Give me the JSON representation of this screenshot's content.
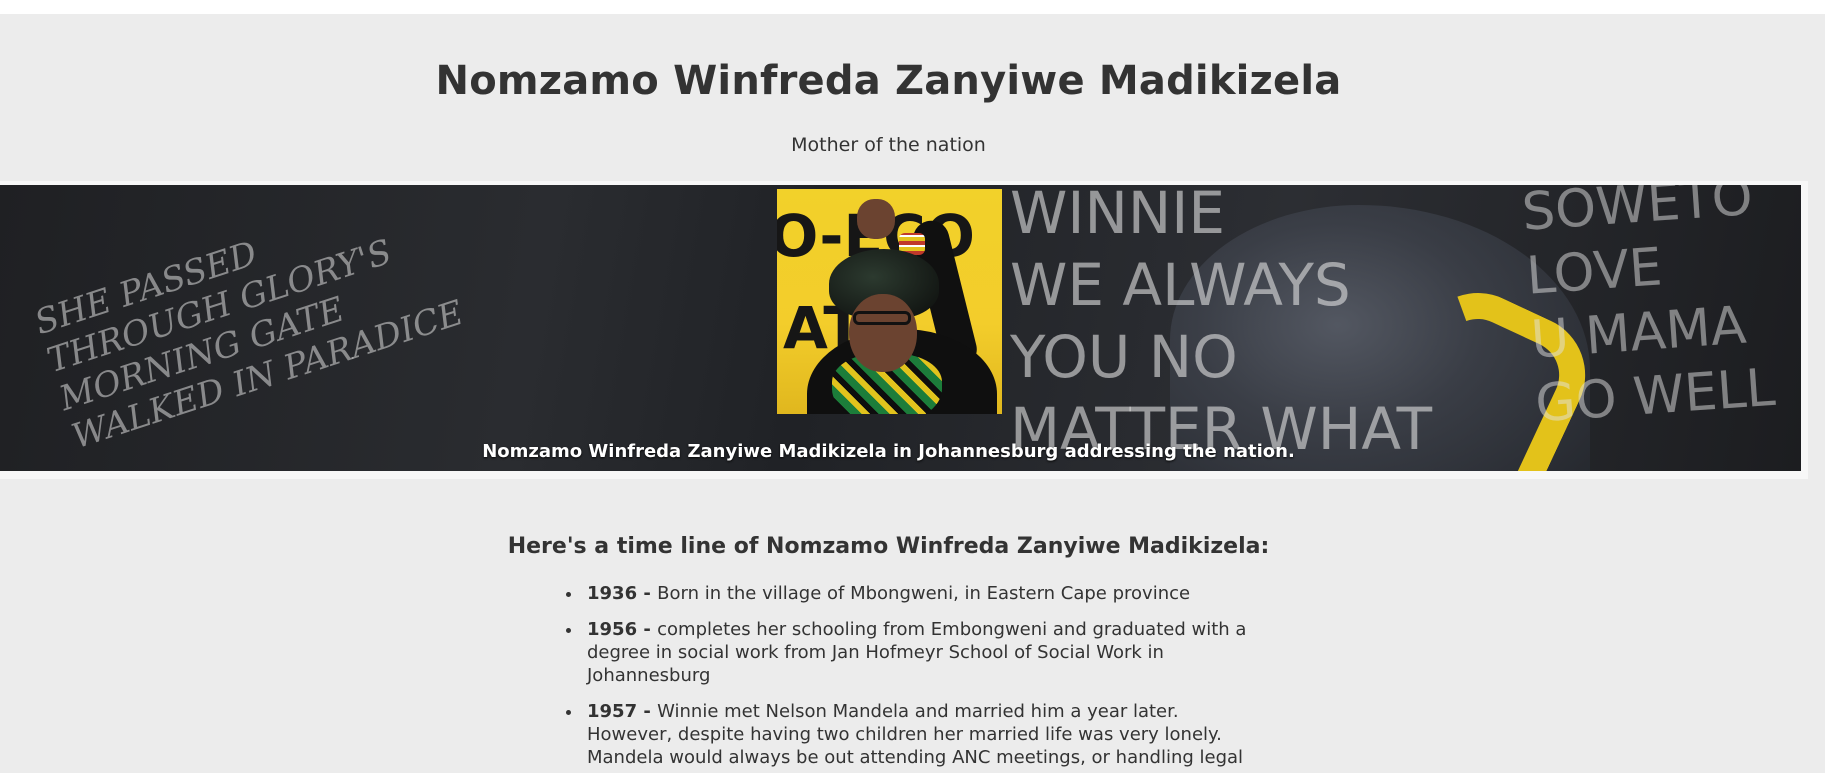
{
  "header": {
    "title": "Nomzamo Winfreda Zanyiwe Madikizela",
    "subtitle": "Mother of the nation"
  },
  "banner": {
    "chalk_left": "SHE PASSED\nTHROUGH GLORY'S\nMORNING GATE\nWALKED IN PARADICE",
    "chalk_right": "WINNIE\nWE ALWAYS\nYOU NO\nMATTER WHAT",
    "chalk_far_right": "SOWETO\nLOVE\nU MAMA\nGO WELL",
    "portrait_text_top": "O-ECO",
    "portrait_text_bottom": "AT",
    "caption": "Nomzamo Winfreda Zanyiwe Madikizela in Johannesburg addressing the nation.",
    "colors": {
      "chalkboard": "#222428",
      "portrait_background": "#f2d12a",
      "beads": "#e3c21a"
    }
  },
  "timeline": {
    "heading": "Here's a time line of Nomzamo Winfreda Zanyiwe Madikizela:",
    "items": [
      {
        "year": "1936",
        "text": "Born in the village of Mbongweni, in Eastern Cape province"
      },
      {
        "year": "1956",
        "text": "completes her schooling from Embongweni and graduated with a degree in social work from Jan Hofmeyr School of Social Work in Johannesburg"
      },
      {
        "year": "1957",
        "text": "Winnie met Nelson Mandela and married him a year later. However, despite having two children her married life was very lonely. Mandela would always be out attending ANC meetings, or handling legal"
      }
    ],
    "separator": " - "
  },
  "colors": {
    "page_background": "#ececec",
    "text": "#333333"
  }
}
